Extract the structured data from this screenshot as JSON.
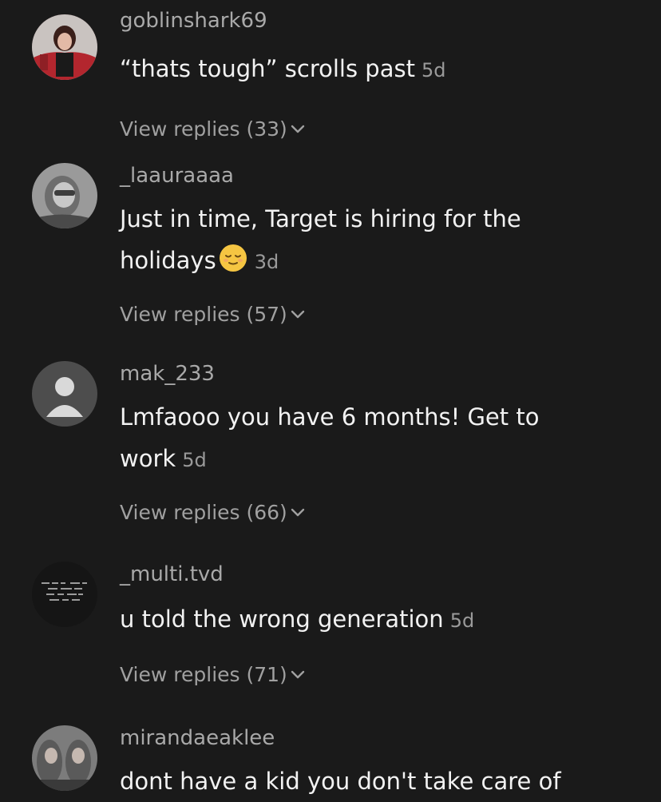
{
  "comments": [
    {
      "username": "goblinshark69",
      "text": "“thats tough” scrolls past",
      "time": "5d",
      "replies_label": "View replies (33)",
      "avatar_icon": "profile-photo",
      "emoji": null
    },
    {
      "username": "_laauraaaa",
      "text": "Just in time, Target is hiring for the holidays",
      "time": "3d",
      "replies_label": "View replies (57)",
      "avatar_icon": "profile-photo",
      "emoji": "relieved-face-emoji"
    },
    {
      "username": "mak_233",
      "text": "Lmfaooo you have 6 months! Get to work",
      "time": "5d",
      "replies_label": "View replies (66)",
      "avatar_icon": "default-user-icon",
      "emoji": null
    },
    {
      "username": "_multi.tvd",
      "text": "u told the wrong generation",
      "time": "5d",
      "replies_label": "View replies (71)",
      "avatar_icon": "profile-photo",
      "emoji": null
    },
    {
      "username": "mirandaeaklee",
      "text": "dont have a kid you don't take care of",
      "time": "",
      "replies_label": "",
      "avatar_icon": "profile-photo",
      "emoji": null
    }
  ],
  "colors": {
    "background": "#1a1a1a",
    "username": "#a9a9a9",
    "comment_text": "#f2f2f2",
    "secondary": "#a0a0a0"
  }
}
